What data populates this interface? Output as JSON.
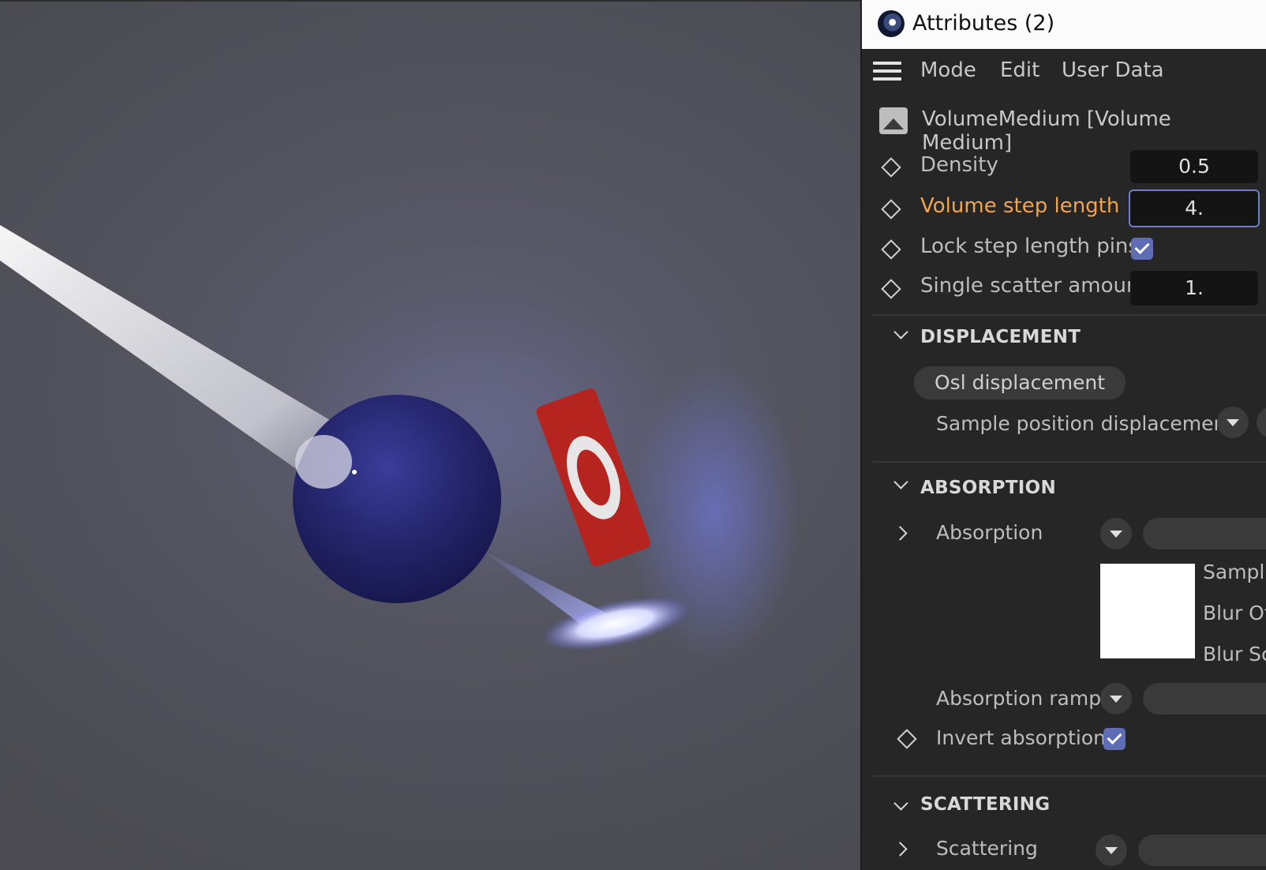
{
  "window": {
    "title": "Attributes (2)"
  },
  "menu": {
    "items": [
      "Mode",
      "Edit",
      "User Data"
    ]
  },
  "object": {
    "title": "VolumeMedium [Volume Medium]"
  },
  "params": {
    "density": {
      "label": "Density",
      "value": "0.5"
    },
    "step_length": {
      "label": "Volume step length",
      "value": "4."
    },
    "lock_pins": {
      "label": "Lock step length pins",
      "checked": true
    },
    "single_scatter": {
      "label": "Single scatter amount",
      "value": "1."
    }
  },
  "displacement": {
    "title": "DISPLACEMENT",
    "osl_button": "Osl displacement",
    "sample_position": "Sample position displacement"
  },
  "absorption": {
    "title": "ABSORPTION",
    "absorption_label": "Absorption",
    "sub_labels": [
      "Samplin",
      "Blur Of",
      "Blur Sc"
    ],
    "ramp_label": "Absorption ramp",
    "invert_label": "Invert absorption",
    "invert_checked": true
  },
  "scattering": {
    "title": "SCATTERING",
    "scattering_label": "Scattering"
  },
  "colors": {
    "accent": "#5f6db5",
    "active_label": "#f2a34c",
    "panel_bg": "#262626"
  }
}
